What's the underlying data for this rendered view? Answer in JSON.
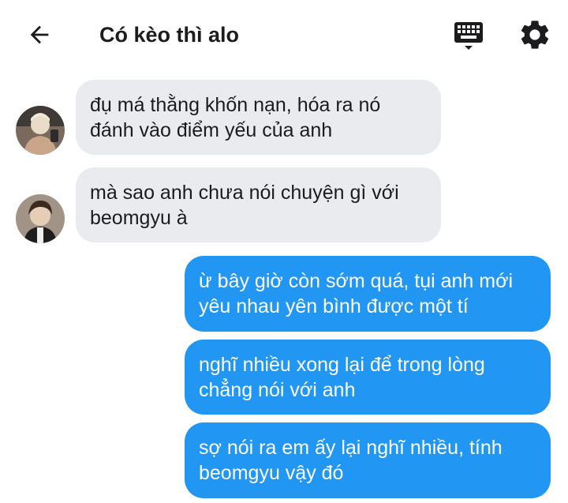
{
  "header": {
    "title": "Có kèo thì alo",
    "back_icon": "arrow-left-icon",
    "keyboard_icon": "keyboard-icon",
    "settings_icon": "gear-icon"
  },
  "messages": [
    {
      "direction": "incoming",
      "text": "đụ má thằng khốn nạn, hóa ra nó đánh vào điểm yếu của anh",
      "avatar": "avatar-1"
    },
    {
      "direction": "incoming",
      "text": "mà sao anh chưa nói chuyện gì với beomgyu à",
      "avatar": "avatar-2"
    },
    {
      "direction": "outgoing",
      "text": "ừ bây giờ còn sớm quá, tụi anh mới yêu nhau yên bình được một tí"
    },
    {
      "direction": "outgoing",
      "text": "nghĩ nhiều xong lại để trong lòng chẳng nói với anh"
    },
    {
      "direction": "outgoing",
      "text": "sợ nói ra em ấy lại nghĩ nhiều, tính beomgyu vậy đó"
    }
  ],
  "colors": {
    "incoming_bubble": "#e9ebef",
    "outgoing_bubble": "#2196f3",
    "outgoing_text": "#ffffff",
    "incoming_text": "#1c1c1e"
  }
}
